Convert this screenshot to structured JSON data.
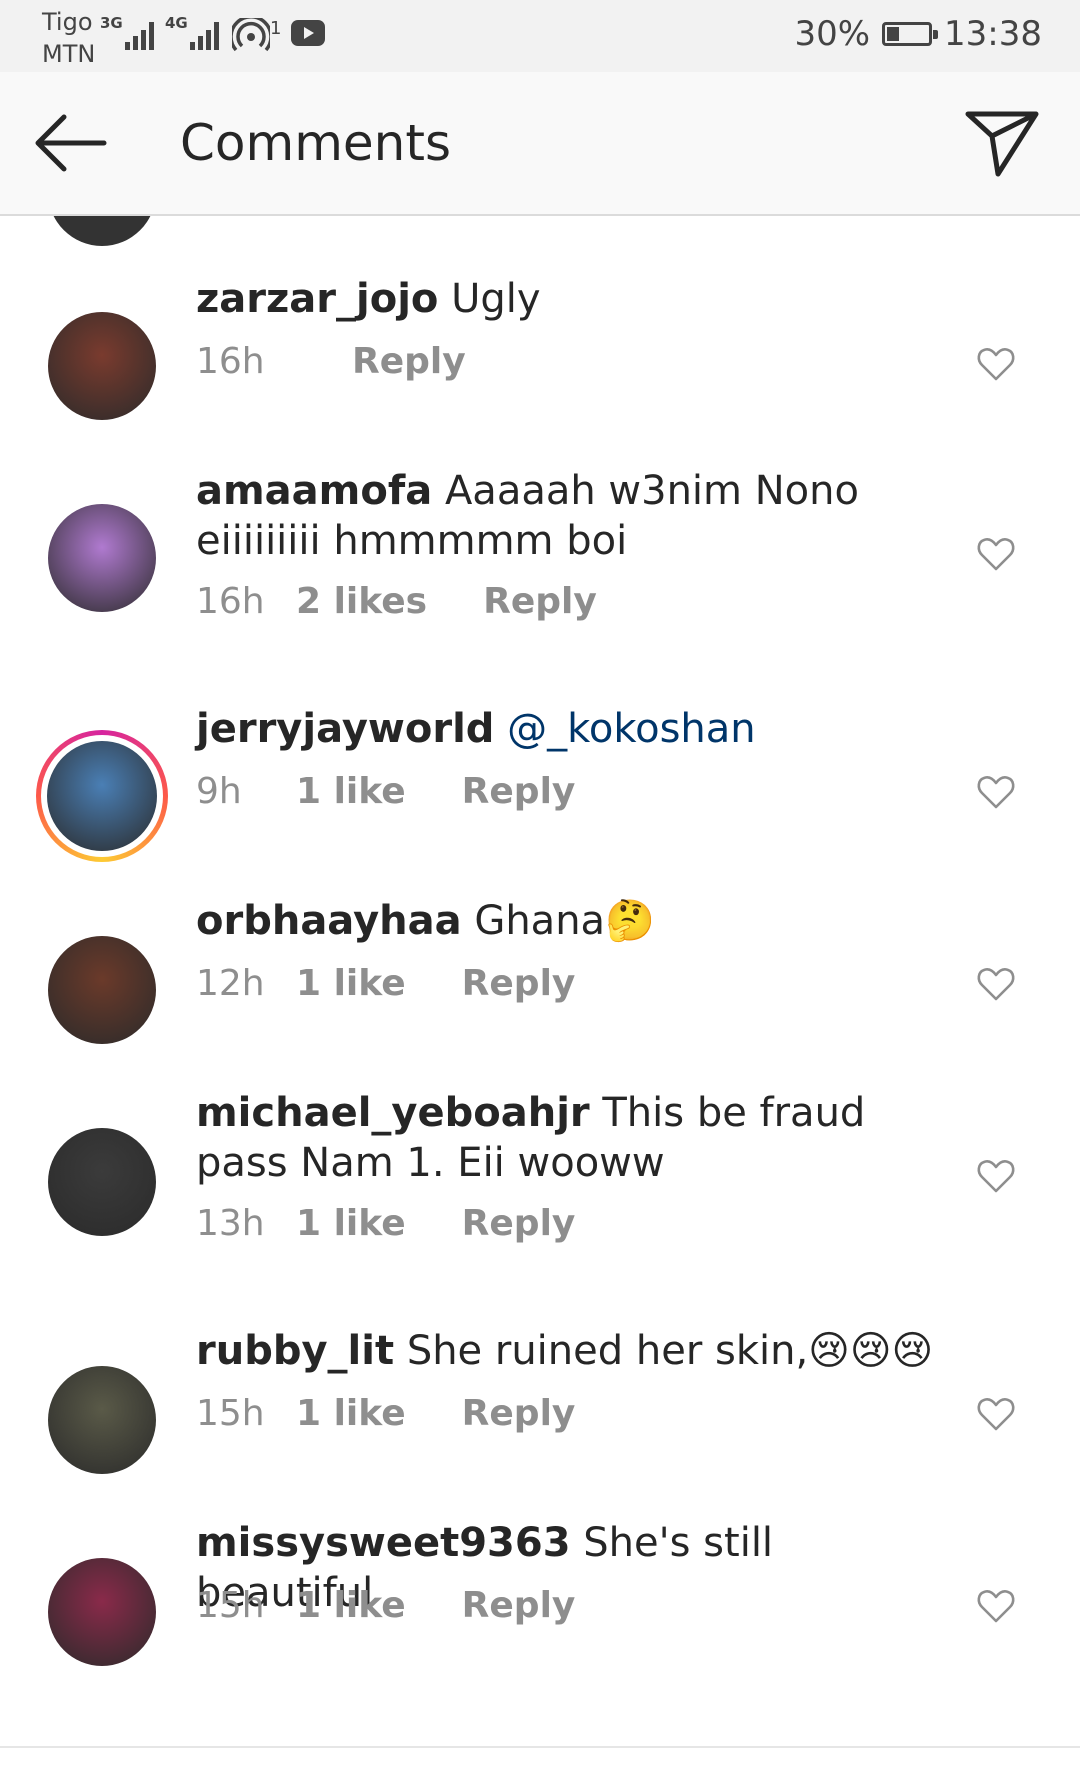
{
  "status_bar": {
    "carrier_1": "Tigo",
    "carrier_2": "MTN",
    "net_1": "3G",
    "net_2": "4G",
    "hotspot_count": "1",
    "battery": "30%",
    "time": "13:38"
  },
  "header": {
    "title": "Comments"
  },
  "comments": [
    {
      "username": "zarzar_jojo",
      "text": "Ugly",
      "time": "16h",
      "likes": "",
      "reply": "Reply",
      "avatar_color": "#7a3b2e"
    },
    {
      "username": "amaamofa",
      "text": "Aaaaah w3nim Nono eiiiiiiiii hmmmmm boi",
      "time": "16h",
      "likes": "2 likes",
      "reply": "Reply",
      "avatar_color": "#b07ad0"
    },
    {
      "username": "jerryjayworld",
      "mention": "@_kokoshan",
      "time": "9h",
      "likes": "1 like",
      "reply": "Reply",
      "avatar_color": "#4a7fb5"
    },
    {
      "username": "orbhaayhaa",
      "text": "Ghana🤔",
      "time": "12h",
      "likes": "1 like",
      "reply": "Reply",
      "avatar_color": "#6b3a2a"
    },
    {
      "username": "michael_yeboahjr",
      "text": "This be fraud pass Nam 1.  Eii wooww",
      "time": "13h",
      "likes": "1 like",
      "reply": "Reply",
      "avatar_color": "#3b3b3b"
    },
    {
      "username": "rubby_lit",
      "text": "She ruined her skin,😢😢😢",
      "time": "15h",
      "likes": "1 like",
      "reply": "Reply",
      "avatar_color": "#5a5a48"
    },
    {
      "username": "missysweet9363",
      "text": "She's still beautiful",
      "time": "15h",
      "likes": "1 like",
      "reply": "Reply",
      "avatar_color": "#8a2a4a"
    }
  ]
}
